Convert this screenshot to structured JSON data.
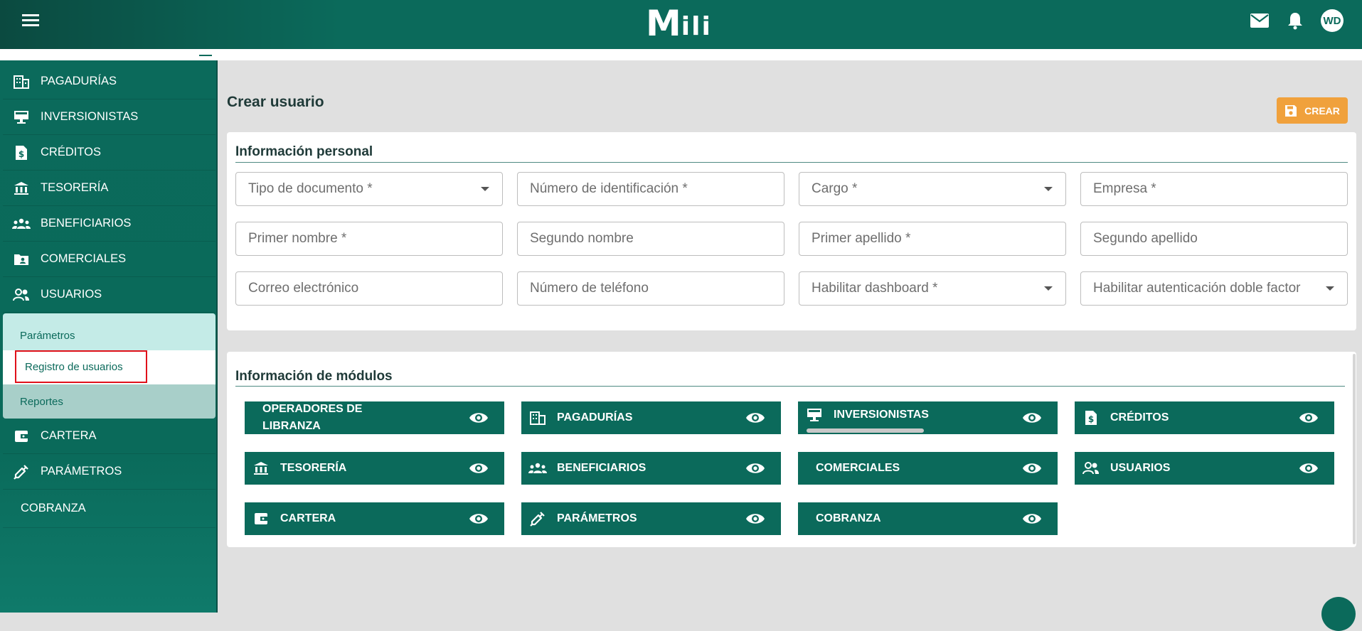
{
  "header": {
    "logo_m": "M",
    "logo_rest": "ili",
    "avatar_initials": "WD",
    "icons": [
      "menu-icon",
      "mail-icon",
      "bell-icon"
    ]
  },
  "sidebar": {
    "items": [
      {
        "label": "PAGADURÍAS",
        "icon": "building-icon"
      },
      {
        "label": "INVERSIONISTAS",
        "icon": "monitor-icon"
      },
      {
        "label": "CRÉDITOS",
        "icon": "dollar-document-icon"
      },
      {
        "label": "TESORERÍA",
        "icon": "bank-icon"
      },
      {
        "label": "BENEFICIARIOS",
        "icon": "group-icon"
      },
      {
        "label": "COMERCIALES",
        "icon": "folder-user-icon"
      },
      {
        "label": "USUARIOS",
        "icon": "users-icon"
      },
      {
        "label": "CARTERA",
        "icon": "wallet-icon"
      },
      {
        "label": "PARÁMETROS",
        "icon": "syringe-icon"
      },
      {
        "label": "COBRANZA",
        "icon": ""
      }
    ],
    "submenu": {
      "parametros": "Parámetros",
      "registro": "Registro de usuarios",
      "reportes": "Reportes"
    }
  },
  "page": {
    "title": "Crear usuario",
    "crear_button": "CREAR"
  },
  "personal": {
    "title": "Información personal",
    "fields": [
      {
        "placeholder": "Tipo de documento *",
        "select": true
      },
      {
        "placeholder": "Número de identificación *",
        "select": false
      },
      {
        "placeholder": "Cargo *",
        "select": true
      },
      {
        "placeholder": "Empresa *",
        "select": false
      },
      {
        "placeholder": "Primer nombre *",
        "select": false
      },
      {
        "placeholder": "Segundo nombre",
        "select": false
      },
      {
        "placeholder": "Primer apellido *",
        "select": false
      },
      {
        "placeholder": "Segundo apellido",
        "select": false
      },
      {
        "placeholder": "Correo electrónico",
        "select": false
      },
      {
        "placeholder": "Número de teléfono",
        "select": false
      },
      {
        "placeholder": "Habilitar dashboard *",
        "select": true
      },
      {
        "placeholder": "Habilitar autenticación doble factor",
        "select": true
      }
    ]
  },
  "modules": {
    "title": "Información de módulos",
    "items": [
      {
        "label": "OPERADORES DE LIBRANZA",
        "icon": ""
      },
      {
        "label": "PAGADURÍAS",
        "icon": "building-icon"
      },
      {
        "label": "INVERSIONISTAS",
        "icon": "monitor-icon"
      },
      {
        "label": "CRÉDITOS",
        "icon": "dollar-document-icon"
      },
      {
        "label": "TESORERÍA",
        "icon": "bank-icon"
      },
      {
        "label": "BENEFICIARIOS",
        "icon": "group-icon"
      },
      {
        "label": "COMERCIALES",
        "icon": ""
      },
      {
        "label": "USUARIOS",
        "icon": "users-icon"
      },
      {
        "label": "CARTERA",
        "icon": "wallet-icon"
      },
      {
        "label": "PARÁMETROS",
        "icon": "syringe-icon"
      },
      {
        "label": "COBRANZA",
        "icon": ""
      }
    ]
  },
  "colors": {
    "primary": "#0b6a5b",
    "accent": "#f0a13c",
    "highlight": "#e0101a",
    "submenu_light": "#c4ebe7"
  }
}
